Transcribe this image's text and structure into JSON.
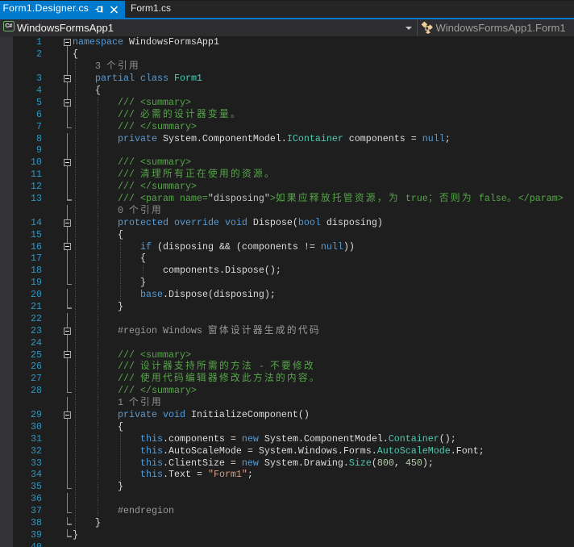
{
  "window": {
    "app": "Visual Studio code editor",
    "theme": "dark"
  },
  "colors": {
    "accent_blue": "#007acc",
    "editor_background": "#1e1e1e",
    "tabstrip_background": "#252526",
    "navbar_background": "#2d2d30",
    "glyph_margin": "#333337",
    "keyword": "#569cd6",
    "type_name": "#4ec9b0",
    "plain_text": "#dcdcdc",
    "comment": "#57a64a",
    "xml_attr_value": "#c8c8c8",
    "string_literal": "#d69d85",
    "number_literal": "#b5cea8",
    "preprocessor": "#9b9b9b",
    "codelens_text": "#8f8f8f",
    "line_number": "#2e96c0"
  },
  "tabs": {
    "active": {
      "label": "Form1.Designer.cs",
      "pin_icon": "pin-icon",
      "close_icon": "close-icon"
    },
    "inactive": {
      "label": "Form1.cs"
    }
  },
  "navbar": {
    "project": {
      "icon": "csharp-project-icon",
      "icon_text": "C#",
      "label": "WindowsFormsApp1",
      "dropdown_icon": "chevron-down-icon"
    },
    "type": {
      "icon": "class-icon",
      "label": "WindowsFormsApp1.Form1"
    }
  },
  "editor": {
    "language": "C#",
    "guides": [
      {
        "level": 0,
        "from": 2,
        "to": 40
      },
      {
        "level": 1,
        "from": 5,
        "to": 39
      },
      {
        "level": 2,
        "from": 17,
        "to": 21
      },
      {
        "level": 3,
        "from": 19,
        "to": 19
      },
      {
        "level": 2,
        "from": 33,
        "to": 36
      }
    ],
    "rows": [
      {
        "n": "1",
        "fold": "box0",
        "ind": 0,
        "segs": [
          [
            "kw",
            "namespace"
          ],
          [
            "pl",
            " WindowsFormsApp1"
          ]
        ]
      },
      {
        "n": "2",
        "fold": "line",
        "ind": 0,
        "segs": [
          [
            "pl",
            "{"
          ]
        ]
      },
      {
        "n": null,
        "fold": "line",
        "ind": 4,
        "lens": true,
        "segs": [
          [
            "cl",
            "3 个引用"
          ]
        ]
      },
      {
        "n": "3",
        "fold": "box",
        "ind": 4,
        "segs": [
          [
            "kw",
            "partial"
          ],
          [
            "pl",
            " "
          ],
          [
            "kw",
            "class"
          ],
          [
            "pl",
            " "
          ],
          [
            "ty",
            "Form1"
          ]
        ]
      },
      {
        "n": "4",
        "fold": "line",
        "ind": 4,
        "segs": [
          [
            "pl",
            "{"
          ]
        ]
      },
      {
        "n": "5",
        "fold": "box",
        "ind": 8,
        "segs": [
          [
            "cm",
            "/// <summary>"
          ]
        ]
      },
      {
        "n": "6",
        "fold": "line",
        "ind": 8,
        "segs": [
          [
            "cm",
            "/// 必需的设计器变量。"
          ]
        ]
      },
      {
        "n": "7",
        "fold": "tick",
        "ind": 8,
        "segs": [
          [
            "cm",
            "/// </summary>"
          ]
        ]
      },
      {
        "n": "8",
        "fold": "line",
        "ind": 8,
        "segs": [
          [
            "kw",
            "private"
          ],
          [
            "pl",
            " System.ComponentModel."
          ],
          [
            "ty",
            "IContainer"
          ],
          [
            "pl",
            " components = "
          ],
          [
            "kw",
            "null"
          ],
          [
            "pl",
            ";"
          ]
        ]
      },
      {
        "n": "9",
        "fold": "line",
        "ind": 0,
        "segs": []
      },
      {
        "n": "10",
        "fold": "box",
        "ind": 8,
        "segs": [
          [
            "cm",
            "/// <summary>"
          ]
        ]
      },
      {
        "n": "11",
        "fold": "line",
        "ind": 8,
        "segs": [
          [
            "cm",
            "/// 清理所有正在使用的资源。"
          ]
        ]
      },
      {
        "n": "12",
        "fold": "line",
        "ind": 8,
        "segs": [
          [
            "cm",
            "/// </summary>"
          ]
        ]
      },
      {
        "n": "13",
        "fold": "tick",
        "ind": 8,
        "segs": [
          [
            "cm",
            "/// <param name="
          ],
          [
            "xa",
            "\"disposing\""
          ],
          [
            "cm",
            ">如果应释放托管资源，为 true；否则为 false。</param>"
          ]
        ]
      },
      {
        "n": null,
        "fold": "line",
        "ind": 8,
        "lens": true,
        "segs": [
          [
            "cl",
            "0 个引用"
          ]
        ]
      },
      {
        "n": "14",
        "fold": "box",
        "ind": 8,
        "segs": [
          [
            "kw",
            "protected"
          ],
          [
            "pl",
            " "
          ],
          [
            "kw",
            "override"
          ],
          [
            "pl",
            " "
          ],
          [
            "kw",
            "void"
          ],
          [
            "pl",
            " Dispose("
          ],
          [
            "kw",
            "bool"
          ],
          [
            "pl",
            " disposing)"
          ]
        ]
      },
      {
        "n": "15",
        "fold": "line",
        "ind": 8,
        "segs": [
          [
            "pl",
            "{"
          ]
        ]
      },
      {
        "n": "16",
        "fold": "box",
        "ind": 12,
        "segs": [
          [
            "kw",
            "if"
          ],
          [
            "pl",
            " (disposing && (components != "
          ],
          [
            "kw",
            "null"
          ],
          [
            "pl",
            "))"
          ]
        ]
      },
      {
        "n": "17",
        "fold": "line",
        "ind": 12,
        "segs": [
          [
            "pl",
            "{"
          ]
        ]
      },
      {
        "n": "18",
        "fold": "line",
        "ind": 16,
        "segs": [
          [
            "pl",
            "components.Dispose();"
          ]
        ]
      },
      {
        "n": "19",
        "fold": "tick",
        "ind": 12,
        "segs": [
          [
            "pl",
            "}"
          ]
        ]
      },
      {
        "n": "20",
        "fold": "line",
        "ind": 12,
        "segs": [
          [
            "kw",
            "base"
          ],
          [
            "pl",
            ".Dispose(disposing);"
          ]
        ]
      },
      {
        "n": "21",
        "fold": "tick",
        "ind": 8,
        "segs": [
          [
            "pl",
            "}"
          ]
        ]
      },
      {
        "n": "22",
        "fold": "line",
        "ind": 0,
        "segs": []
      },
      {
        "n": "23",
        "fold": "box",
        "ind": 8,
        "segs": [
          [
            "pp",
            "#region Windows 窗体设计器生成的代码"
          ]
        ]
      },
      {
        "n": "24",
        "fold": "line",
        "ind": 0,
        "segs": []
      },
      {
        "n": "25",
        "fold": "box",
        "ind": 8,
        "segs": [
          [
            "cm",
            "/// <summary>"
          ]
        ]
      },
      {
        "n": "26",
        "fold": "line",
        "ind": 8,
        "segs": [
          [
            "cm",
            "/// 设计器支持所需的方法 - 不要修改"
          ]
        ]
      },
      {
        "n": "27",
        "fold": "line",
        "ind": 8,
        "segs": [
          [
            "cm",
            "/// 使用代码编辑器修改此方法的内容。"
          ]
        ]
      },
      {
        "n": "28",
        "fold": "tick",
        "ind": 8,
        "segs": [
          [
            "cm",
            "/// </summary>"
          ]
        ]
      },
      {
        "n": null,
        "fold": "line",
        "ind": 8,
        "lens": true,
        "segs": [
          [
            "cl",
            "1 个引用"
          ]
        ]
      },
      {
        "n": "29",
        "fold": "box",
        "ind": 8,
        "segs": [
          [
            "kw",
            "private"
          ],
          [
            "pl",
            " "
          ],
          [
            "kw",
            "void"
          ],
          [
            "pl",
            " InitializeComponent()"
          ]
        ]
      },
      {
        "n": "30",
        "fold": "line",
        "ind": 8,
        "segs": [
          [
            "pl",
            "{"
          ]
        ]
      },
      {
        "n": "31",
        "fold": "line",
        "ind": 12,
        "segs": [
          [
            "kw",
            "this"
          ],
          [
            "pl",
            ".components = "
          ],
          [
            "kw",
            "new"
          ],
          [
            "pl",
            " System.ComponentModel."
          ],
          [
            "ty",
            "Container"
          ],
          [
            "pl",
            "();"
          ]
        ]
      },
      {
        "n": "32",
        "fold": "line",
        "ind": 12,
        "segs": [
          [
            "kw",
            "this"
          ],
          [
            "pl",
            ".AutoScaleMode = System.Windows.Forms."
          ],
          [
            "ty",
            "AutoScaleMode"
          ],
          [
            "pl",
            ".Font;"
          ]
        ]
      },
      {
        "n": "33",
        "fold": "line",
        "ind": 12,
        "segs": [
          [
            "kw",
            "this"
          ],
          [
            "pl",
            ".ClientSize = "
          ],
          [
            "kw",
            "new"
          ],
          [
            "pl",
            " System.Drawing."
          ],
          [
            "ty",
            "Size"
          ],
          [
            "pl",
            "("
          ],
          [
            "nu",
            "800"
          ],
          [
            "pl",
            ", "
          ],
          [
            "nu",
            "450"
          ],
          [
            "pl",
            ");"
          ]
        ]
      },
      {
        "n": "34",
        "fold": "line",
        "ind": 12,
        "segs": [
          [
            "kw",
            "this"
          ],
          [
            "pl",
            ".Text = "
          ],
          [
            "st",
            "\"Form1\""
          ],
          [
            "pl",
            ";"
          ]
        ]
      },
      {
        "n": "35",
        "fold": "tick",
        "ind": 8,
        "segs": [
          [
            "pl",
            "}"
          ]
        ]
      },
      {
        "n": "36",
        "fold": "line",
        "ind": 0,
        "segs": []
      },
      {
        "n": "37",
        "fold": "tick",
        "ind": 8,
        "segs": [
          [
            "pp",
            "#endregion"
          ]
        ]
      },
      {
        "n": "38",
        "fold": "tick",
        "ind": 4,
        "segs": [
          [
            "pl",
            "}"
          ]
        ]
      },
      {
        "n": "39",
        "fold": "tick",
        "ind": 0,
        "segs": [
          [
            "pl",
            "}"
          ]
        ]
      },
      {
        "n": "40",
        "fold": "",
        "ind": 0,
        "segs": []
      }
    ]
  }
}
